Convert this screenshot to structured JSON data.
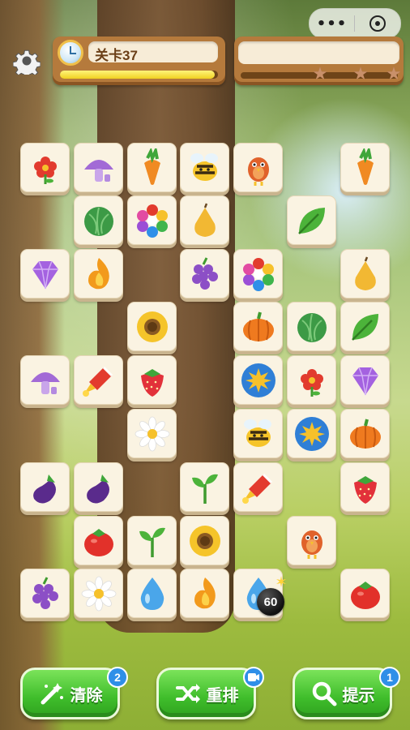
{
  "top_bar": {
    "menu_dots": "•••",
    "level_label": "关卡37",
    "level_progress": 0.98,
    "stars_earned": 0,
    "stars_total": 3
  },
  "colors": {
    "tile_face": "#faf3e2",
    "panel_wood": "#b57a3c",
    "button_green": "#3fbd2b",
    "badge_blue": "#2f8fe8"
  },
  "board": {
    "bomb_counter": "60",
    "tiles": [
      {
        "icon": "flower-icon"
      },
      {
        "icon": "mushroom-icon"
      },
      {
        "icon": "carrot-icon"
      },
      {
        "icon": "bee-icon"
      },
      {
        "icon": "bird-icon"
      },
      {
        "icon": "carrot-icon"
      },
      {
        "icon": "cabbage-icon"
      },
      {
        "icon": "rainbow-flower-icon"
      },
      {
        "icon": "pear-icon"
      },
      {
        "icon": "leaf-icon"
      },
      {
        "icon": "gem-icon"
      },
      {
        "icon": "flame-icon"
      },
      {
        "icon": "grape-icon"
      },
      {
        "icon": "rainbow-flower-icon"
      },
      {
        "icon": "pear-icon"
      },
      {
        "icon": "sunflower-icon"
      },
      {
        "icon": "pumpkin-icon"
      },
      {
        "icon": "cabbage-icon"
      },
      {
        "icon": "leaf-icon"
      },
      {
        "icon": "mushroom-icon"
      },
      {
        "icon": "rocket-icon"
      },
      {
        "icon": "strawberry-icon"
      },
      {
        "icon": "sun-badge-icon"
      },
      {
        "icon": "flower-icon"
      },
      {
        "icon": "gem-icon"
      },
      {
        "icon": "daisy-icon"
      },
      {
        "icon": "bee-icon"
      },
      {
        "icon": "sun-badge-icon"
      },
      {
        "icon": "pumpkin-icon"
      },
      {
        "icon": "eggplant-icon"
      },
      {
        "icon": "eggplant-icon"
      },
      {
        "icon": "sprout-icon"
      },
      {
        "icon": "rocket-icon"
      },
      {
        "icon": "strawberry-icon"
      },
      {
        "icon": "tomato-icon"
      },
      {
        "icon": "sprout-icon"
      },
      {
        "icon": "sunflower-icon"
      },
      {
        "icon": "bird-icon"
      },
      {
        "icon": "grape-icon"
      },
      {
        "icon": "daisy-icon"
      },
      {
        "icon": "water-drop-icon"
      },
      {
        "icon": "flame-icon"
      },
      {
        "icon": "water-drop-icon"
      },
      {
        "icon": "tomato-icon"
      }
    ]
  },
  "buttons": {
    "clear": {
      "label": "清除",
      "badge": "2"
    },
    "shuffle": {
      "label": "重排"
    },
    "hint": {
      "label": "提示",
      "badge": "1"
    }
  }
}
